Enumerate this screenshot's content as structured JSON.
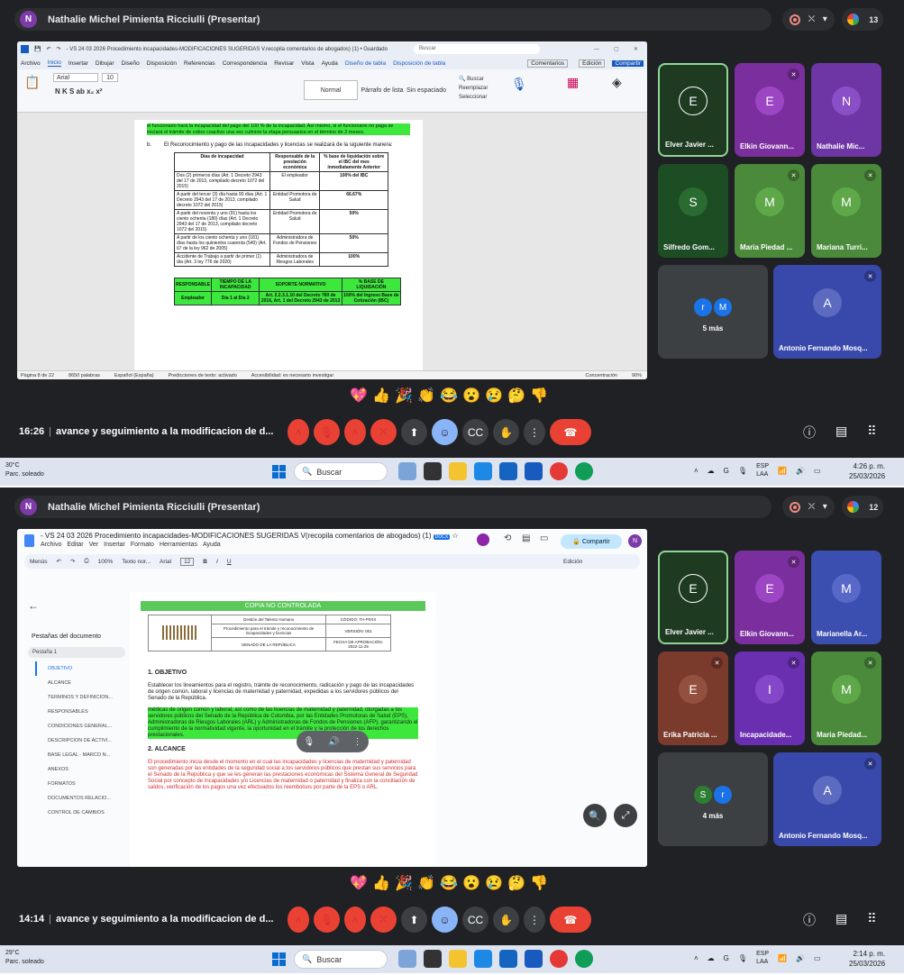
{
  "screens": [
    {
      "presenter": {
        "initial": "N",
        "name": "Nathalie Michel Pimienta Ricciulli (Presentar)"
      },
      "participant_count": "13",
      "tiles": [
        {
          "initial": "E",
          "name": "Elver Javier ...",
          "bg": "#1e3b22",
          "av_bg": "#1e3b22",
          "muted": false
        },
        {
          "initial": "E",
          "name": "Elkin Giovann...",
          "bg": "#7b2f9e",
          "av_bg": "#7b2f9e",
          "muted": true
        },
        {
          "initial": "N",
          "name": "Nathalie Mic...",
          "bg": "#6e35a5",
          "av_bg": "#6e35a5",
          "muted": false
        },
        {
          "initial": "S",
          "name": "Silfredo Gom...",
          "bg": "#1d4d23",
          "av_bg": "#1d4d23",
          "muted": false
        },
        {
          "initial": "M",
          "name": "Maria Piedad ...",
          "bg": "#4a8a3a",
          "av_bg": "#4a8a3a",
          "muted": true
        },
        {
          "initial": "M",
          "name": "Mariana Turri...",
          "bg": "#4a8a3a",
          "av_bg": "#4a8a3a",
          "muted": true
        }
      ],
      "more": {
        "a": "r",
        "b": "M",
        "label": "5 más"
      },
      "last_tile": {
        "initial": "A",
        "name": "Antonio Fernando Mosq...",
        "bg": "#3949ab"
      },
      "clock": "16:26",
      "meeting_title": "avance y seguimiento a la modificacion de d...",
      "taskbar": {
        "temp": "30°C",
        "weather": "Parc. soleado",
        "search": "Buscar",
        "lang1": "ESP",
        "lang2": "LAA",
        "time": "4:26 p. m.",
        "date": "25/03/2026"
      },
      "word": {
        "title": "- VS 24 03 2026 Procedimiento incapacidades-MODIFICACIONES SUGERIDAS V.recopila comentarios de abogados) (1) • Guardado",
        "search": "Buscar",
        "menu": [
          "Archivo",
          "Inicio",
          "Insertar",
          "Dibujar",
          "Diseño",
          "Disposición",
          "Referencias",
          "Correspondencia",
          "Revisar",
          "Vista",
          "Ayuda",
          "Diseño de tabla",
          "Disposición de tabla"
        ],
        "font": "Arial",
        "size": "10",
        "styles": [
          "Normal",
          "Párrafo de lista",
          "Sin espaciado"
        ],
        "right_btns": [
          "Comentarios",
          "Edición",
          "Compartir"
        ],
        "para_top": "el funcionario hará la incapacidad del pago del 100 % de la incapacidad. Así mismo, si el funcionario no paga se iniciará el trámite de cobro coactivo una vez culmine la etapa persuasiva en el término de 2 meses.",
        "item": "b.",
        "para_b": "El Reconocimiento y pago de las incapacidades y licencias se realizará de la siguiente manera:",
        "table_head": [
          "Días de incapacidad",
          "Responsable de la prestación económica",
          "% base de liquidación sobre el IBC del mes inmediatamente Anterior"
        ],
        "table_rows": [
          [
            "Dos (2) primeros días (Art. 1 Decreto 2943 del 17 de 2013, compilado decreto 1072 del 2015)",
            "El empleador",
            "100% del IBC"
          ],
          [
            "A partir del tercer (3) día hasta 90 días (Art. 1 Decreto 2943 del 17 de 2013, compilado decreto 1072 del 2015)",
            "Entidad Promotora de Salud",
            "66.67%"
          ],
          [
            "A partir del noventa y uno (91) hasta los ciento ochenta (180) días (Art. 1 Decreto 2943 del 17 de 2013, compilado decreto 1072 del 2015)",
            "Entidad Promotora de Salud",
            "50%"
          ],
          [
            "A partir de los ciento ochenta y uno (181) días hasta los quinientos cuarenta (540) (Art. 67 de la ley 962 de 2005)",
            "Administradora de Fondos de Pensiones",
            "50%"
          ],
          [
            "Accidente de Trabajo a partir de primer (1) día (Art. 3 ley 776 de 2020)",
            "Administradora de Riesgos Laborales",
            "100%"
          ]
        ],
        "resp_head": [
          "RESPONSABLE",
          "TIEMPO DE LA INCAPACIDAD",
          "SOPORTE NORMATIVO",
          "% BASE DE LIQUIDACIÓN"
        ],
        "resp_row": [
          "Empleador",
          "Día 1 al Día 2",
          "Art. 2.2.3.1.10 del Decreto 780 de 2016, Art. 1 del Decreto 2943 de 2013",
          "100% del Ingreso Base de Cotización (IBC)"
        ],
        "status": [
          "Página 8 de 22",
          "8650 palabras",
          "Español (España)",
          "Predicciones de texto: activado",
          "Accesibilidad: es necesario investigar",
          "Concentración",
          "90%"
        ]
      }
    },
    {
      "presenter": {
        "initial": "N",
        "name": "Nathalie Michel Pimienta Ricciulli (Presentar)"
      },
      "participant_count": "12",
      "tiles": [
        {
          "initial": "E",
          "name": "Elver Javier ...",
          "bg": "#1e3b22",
          "av_bg": "#1e3b22",
          "muted": false
        },
        {
          "initial": "E",
          "name": "Elkin Giovann...",
          "bg": "#7b2f9e",
          "av_bg": "#7b2f9e",
          "muted": true
        },
        {
          "initial": "M",
          "name": "Marianella Ar...",
          "bg": "#3b4fb0",
          "av_bg": "#3b4fb0",
          "muted": false
        },
        {
          "initial": "E",
          "name": "Erika Patricia ...",
          "bg": "#7a3a2c",
          "av_bg": "#7a3a2c",
          "muted": true
        },
        {
          "initial": "I",
          "name": "Incapacidade...",
          "bg": "#6a2fb0",
          "av_bg": "#6a2fb0",
          "muted": true
        },
        {
          "initial": "M",
          "name": "Maria Piedad...",
          "bg": "#4a8a3a",
          "av_bg": "#4a8a3a",
          "muted": true
        }
      ],
      "more": {
        "a": "S",
        "b": "r",
        "label": "4 más"
      },
      "last_tile": {
        "initial": "A",
        "name": "Antonio Fernando Mosq...",
        "bg": "#3949ab"
      },
      "clock": "14:14",
      "meeting_title": "avance y seguimiento a la modificacion de d...",
      "taskbar": {
        "temp": "29°C",
        "weather": "Parc. soleado",
        "search": "Buscar",
        "lang1": "ESP",
        "lang2": "LAA",
        "time": "2:14 p. m.",
        "date": "25/03/2026"
      },
      "gdoc": {
        "title": "- VS 24 03 2026 Procedimiento incapacidades-MODIFICACIONES SUGERIDAS V(recopila comentarios de abogados) (1)",
        "badge": "DOCX",
        "menu": [
          "Archivo",
          "Editar",
          "Ver",
          "Insertar",
          "Formato",
          "Herramientas",
          "Ayuda"
        ],
        "share": "Compartir",
        "user": "N",
        "tool": [
          "Menús",
          "100%",
          "Texto nor...",
          "Arial",
          "12",
          "Edición"
        ],
        "outline_title": "Pestañas del documento",
        "tab": "Pestaña 1",
        "outline": [
          "OBJETIVO",
          "ALCANCE",
          "TERMINOS Y DEFINICION...",
          "RESPONSABLES",
          "CONDICIONES GENERAL...",
          "DESCRIPCION DE ACTIVI...",
          "BASE LEGAL - MARCO N...",
          "ANEXOS",
          "FORMATOS",
          "DOCUMENTOS RELACIO...",
          "CONTROL DE CAMBIOS"
        ],
        "banner": "COPIA NO CONTROLADA",
        "hdr_area": "Gestión del Talento Humano",
        "hdr_proc": "Procedimiento para el trámite y reconocimiento de incapacidades y licencias",
        "hdr_code": "CÓDIGO: TH-P0XX",
        "hdr_ver": "VERSIÓN: 001",
        "hdr_senado": "SENADO DE LA REPÚBLICA",
        "hdr_fecha": "FECHA DE APROBACIÓN: 2022-11-25",
        "h1": "1. OBJETIVO",
        "p1a": "Establecer los lineamientos para el registro, trámite de reconocimiento, radicación y pago de las incapacidades de origen común, laboral y licencias de maternidad y paternidad, expedidas a los servidores públicos del Senado de la República.",
        "p1b": "médicas de origen común y laboral, así como de las licencias de maternidad y paternidad, otorgadas a los servidores públicos del Senado de la República de Colombia, por las Entidades Promotoras de Salud (EPS), Administradoras de Riesgos Laborales (ARL) y Administradoras de Fondos de Pensiones (AFP), garantizando el cumplimiento de la normatividad vigente, la oportunidad en el trámite y la protección de los derechos prestacionales.",
        "h2": "2. ALCANCE",
        "p2": "El procedimiento inicia desde el momento en el cual las incapacidades y licencias de maternidad y paternidad son generadas por las entidades de la seguridad social a los servidores públicos que prestan sus servicios para el Senado de la República y que se les generan las prestaciones económicas del Sistema General de Seguridad Social por concepto de Incapacidades y/o Licencias de maternidad o paternidad y finaliza con la conciliación de saldos, verificación de los pagos una vez efectuados los reembolsos por parte de la EPS o ARL."
      }
    }
  ]
}
